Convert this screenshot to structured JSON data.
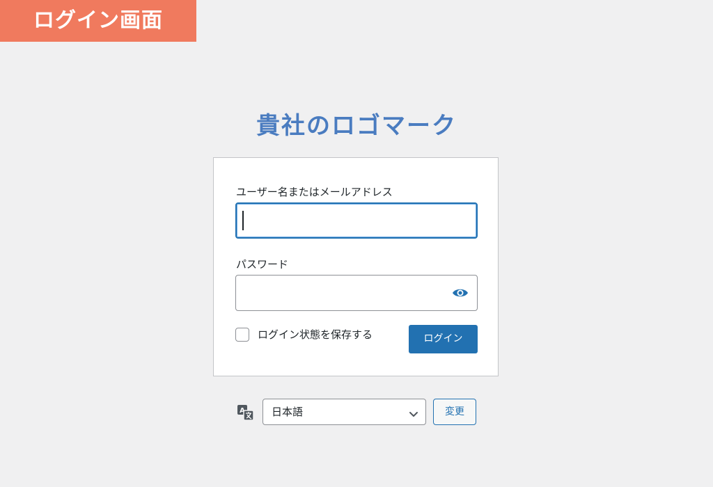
{
  "corner_label": "ログイン画面",
  "logo_text": "貴社のロゴマーク",
  "login_form": {
    "username_label": "ユーザー名またはメールアドレス",
    "username_value": "",
    "password_label": "パスワード",
    "password_value": "",
    "remember_label": "ログイン状態を保存する",
    "remember_checked": false,
    "submit_label": "ログイン"
  },
  "language": {
    "selected": "日本語",
    "change_label": "変更"
  },
  "colors": {
    "accent": "#2271b1",
    "logo": "#4a7cc0",
    "corner_label_bg": "#f07a5e",
    "background": "#f0f0f1"
  },
  "icons": {
    "password_toggle": "eye-icon",
    "language": "translate-icon",
    "select": "chevron-down-icon"
  }
}
